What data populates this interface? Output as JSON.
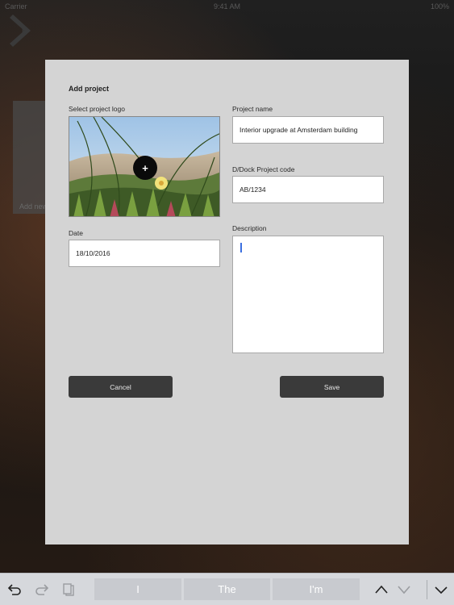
{
  "status_bar": {
    "carrier": "Carrier",
    "time": "9:41 AM",
    "battery": "100%"
  },
  "background": {
    "card_text": "Add new"
  },
  "dialog": {
    "title": "Add project",
    "logo": {
      "label": "Select project logo",
      "add_icon": "plus-icon",
      "add_symbol": "+"
    },
    "project_name": {
      "label": "Project name",
      "value": "Interior upgrade at Amsterdam building"
    },
    "project_code": {
      "label": "D/Dock Project code",
      "value": "AB/1234"
    },
    "date": {
      "label": "Date",
      "value": "18/10/2016"
    },
    "description": {
      "label": "Description",
      "value": ""
    },
    "cancel_label": "Cancel",
    "save_label": "Save"
  },
  "keyboard_bar": {
    "left_icons": [
      "undo-icon",
      "redo-icon",
      "paste-icon"
    ],
    "suggestions": [
      "I",
      "The",
      "I'm"
    ],
    "right_icons": [
      "chevron-up-icon",
      "chevron-down-icon",
      "dismiss-keyboard-icon"
    ]
  },
  "colors": {
    "dialog_bg": "#d4d4d4",
    "button_bg": "#3a3a3a",
    "caret": "#3b6fe0"
  }
}
